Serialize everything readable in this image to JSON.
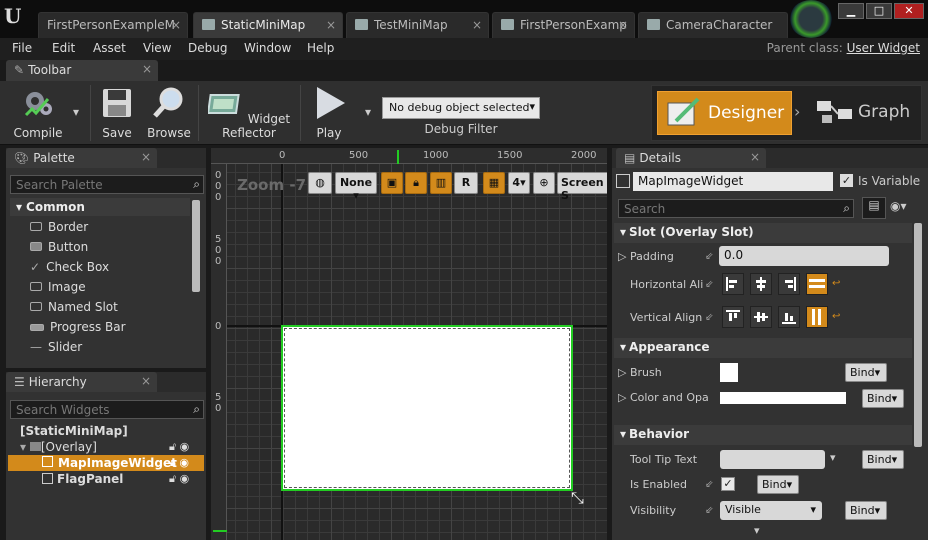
{
  "titlebar": {
    "tabs": [
      {
        "label": "FirstPersonExampleM",
        "active": false
      },
      {
        "label": "StaticMiniMap",
        "active": true
      },
      {
        "label": "TestMiniMap",
        "active": false
      },
      {
        "label": "FirstPersonExamp",
        "active": false
      },
      {
        "label": "CameraCharacter",
        "active": false
      }
    ],
    "close_glyph": "×"
  },
  "menubar": {
    "items": [
      "File",
      "Edit",
      "Asset",
      "View",
      "Debug",
      "Window",
      "Help"
    ],
    "parent_class_label": "Parent class:",
    "parent_class_value": "User Widget"
  },
  "toolbar": {
    "tab_label": "Toolbar",
    "compile": "Compile",
    "save": "Save",
    "browse": "Browse",
    "widget_reflector": "Widget Reflector",
    "play": "Play",
    "debug_select": "No debug object selected",
    "debug_filter": "Debug Filter",
    "designer": "Designer",
    "graph": "Graph"
  },
  "palette": {
    "tab_label": "Palette",
    "search_placeholder": "Search Palette",
    "category": "Common",
    "items": [
      "Border",
      "Button",
      "Check Box",
      "Image",
      "Named Slot",
      "Progress Bar",
      "Slider"
    ]
  },
  "hierarchy": {
    "tab_label": "Hierarchy",
    "search_placeholder": "Search Widgets",
    "root": "[StaticMiniMap]",
    "overlay": "[Overlay]",
    "items": [
      "MapImageWidget",
      "FlagPanel"
    ],
    "selected": "MapImageWidget"
  },
  "canvas": {
    "zoom_label": "Zoom -7",
    "none_label": "None",
    "r_label": "R",
    "grid_value": "4",
    "screen_label": "Screen S",
    "ruler_top": [
      "0",
      "500",
      "1000",
      "1500",
      "2000"
    ],
    "ruler_left": [
      "0",
      "0",
      "0",
      "5",
      "0",
      "0",
      "0",
      "5",
      "0"
    ]
  },
  "details": {
    "tab_label": "Details",
    "widget_name": "MapImageWidget",
    "is_variable_label": "Is Variable",
    "is_variable": true,
    "search_placeholder": "Search",
    "slot_category": "Slot (Overlay Slot)",
    "padding_label": "Padding",
    "padding_value": "0.0",
    "horizontal_label": "Horizontal Ali",
    "vertical_label": "Vertical Align",
    "appearance_category": "Appearance",
    "brush_label": "Brush",
    "color_label": "Color and Opa",
    "behavior_category": "Behavior",
    "tooltip_label": "Tool Tip Text",
    "enabled_label": "Is Enabled",
    "is_enabled": true,
    "visibility_label": "Visibility",
    "visibility_value": "Visible",
    "bind_label": "Bind"
  },
  "colors": {
    "accent": "#d38a1b",
    "selection_outline": "#22cc22"
  }
}
